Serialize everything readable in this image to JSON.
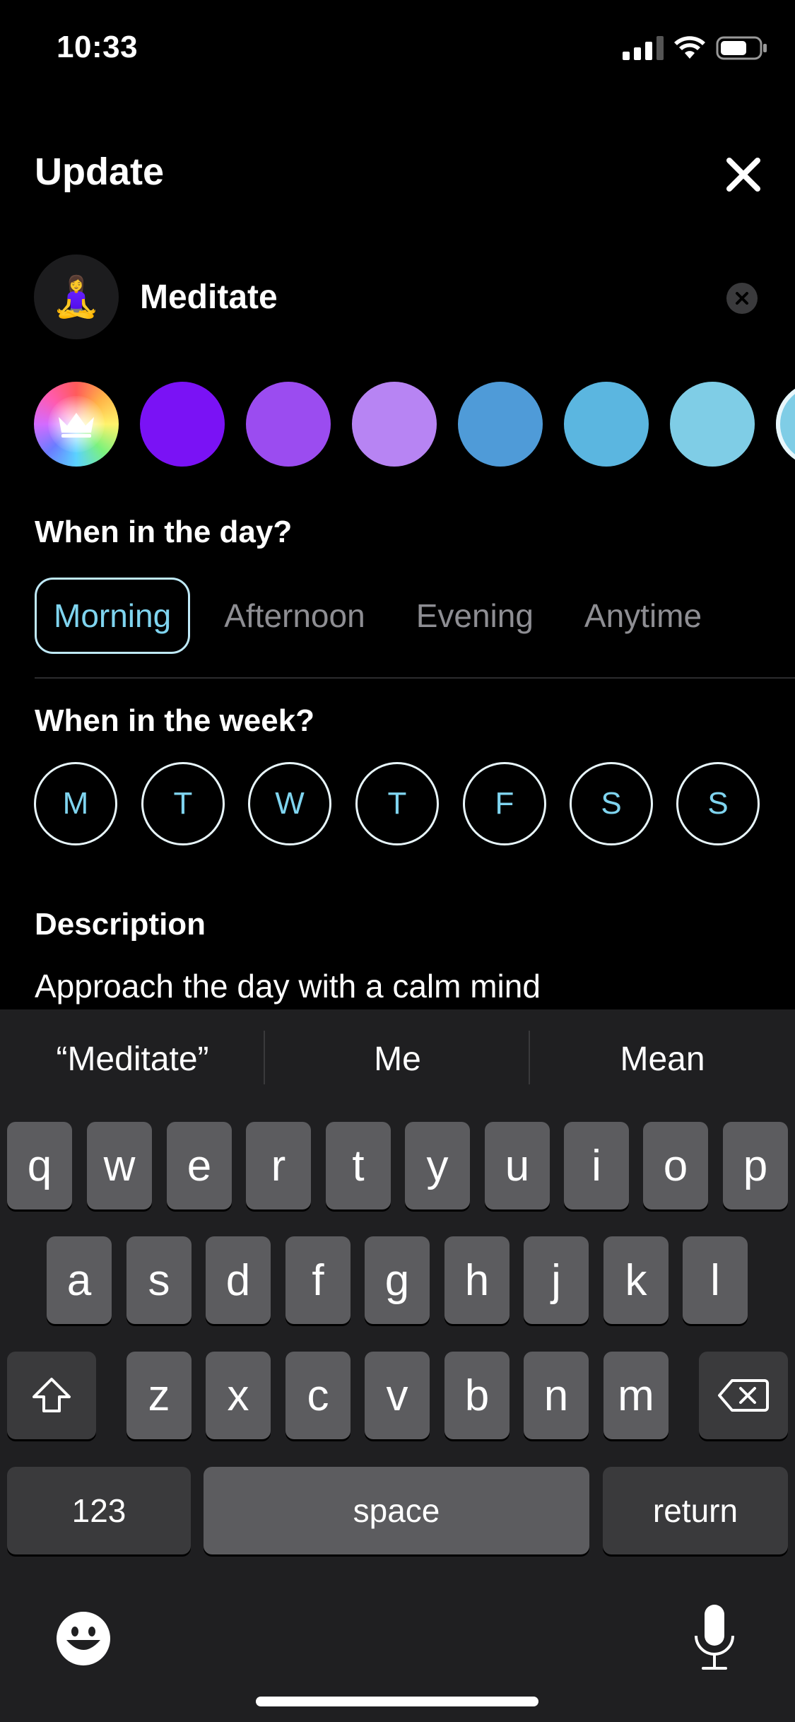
{
  "status_bar": {
    "time": "10:33"
  },
  "header": {
    "title": "Update"
  },
  "habit": {
    "emoji": "🧘‍♀️",
    "name": "Meditate"
  },
  "colors": [
    "premium",
    "#7a12f5",
    "#9b4cf0",
    "#b784f3",
    "#4f9bd8",
    "#5bb6e0",
    "#7fcde6",
    "#b7e6f3"
  ],
  "time_of_day": {
    "label": "When in the day?",
    "options": [
      "Morning",
      "Afternoon",
      "Evening",
      "Anytime"
    ],
    "selected": "Morning"
  },
  "week": {
    "label": "When in the week?",
    "days": [
      "M",
      "T",
      "W",
      "T",
      "F",
      "S",
      "S"
    ]
  },
  "description": {
    "label": "Description",
    "value": "Approach the day with a calm mind"
  },
  "keyboard": {
    "suggestions": [
      "“Meditate”",
      "Me",
      "Mean"
    ],
    "row1": [
      "q",
      "w",
      "e",
      "r",
      "t",
      "y",
      "u",
      "i",
      "o",
      "p"
    ],
    "row2": [
      "a",
      "s",
      "d",
      "f",
      "g",
      "h",
      "j",
      "k",
      "l"
    ],
    "row3": [
      "z",
      "x",
      "c",
      "v",
      "b",
      "n",
      "m"
    ],
    "numbers_label": "123",
    "space_label": "space",
    "return_label": "return"
  }
}
